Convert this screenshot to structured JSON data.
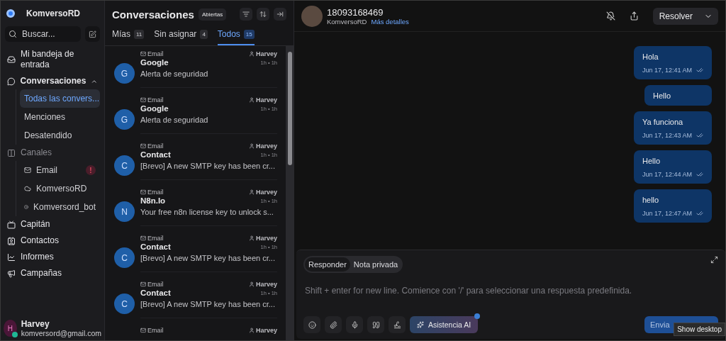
{
  "sidebar": {
    "brand": "KomversoRD",
    "search": {
      "placeholder": "Buscar..."
    },
    "nav": [
      {
        "label": "Mi bandeja de entrada",
        "kind": "link"
      },
      {
        "label": "Conversaciones",
        "kind": "group",
        "expanded": true,
        "children": [
          {
            "label": "Todas las convers...",
            "selected": true
          },
          {
            "label": "Menciones",
            "selected": false
          },
          {
            "label": "Desatendido",
            "selected": false
          }
        ]
      },
      {
        "label": "Canales",
        "kind": "section",
        "children": [
          {
            "label": "Email",
            "alert": "!"
          },
          {
            "label": "KomversoRD"
          },
          {
            "label": "Komversord_bot"
          }
        ]
      },
      {
        "label": "Capitán",
        "kind": "link"
      },
      {
        "label": "Contactos",
        "kind": "link"
      },
      {
        "label": "Informes",
        "kind": "link"
      },
      {
        "label": "Campañas",
        "kind": "link"
      }
    ],
    "user": {
      "initial": "H",
      "name": "Harvey",
      "email": "komversord@gmail.com",
      "online": true
    }
  },
  "list": {
    "title": "Conversaciones",
    "status": "Abiertas",
    "tabs": [
      {
        "label": "Mías",
        "count": "11",
        "selected": false
      },
      {
        "label": "Sin asignar",
        "count": "4",
        "selected": false
      },
      {
        "label": "Todos",
        "count": "15",
        "selected": true
      }
    ],
    "rows": [
      {
        "channel": "Email",
        "assignee": "Harvey",
        "avatar": "G",
        "name": "Google",
        "time": "1h • 1h",
        "preview": "Alerta de seguridad"
      },
      {
        "channel": "Email",
        "assignee": "Harvey",
        "avatar": "G",
        "name": "Google",
        "time": "1h • 1h",
        "preview": "Alerta de seguridad"
      },
      {
        "channel": "Email",
        "assignee": "Harvey",
        "avatar": "C",
        "name": "Contact",
        "time": "1h • 1h",
        "preview": "[Brevo] A new SMTP key has been cr..."
      },
      {
        "channel": "Email",
        "assignee": "Harvey",
        "avatar": "N",
        "name": "N8n.Io",
        "time": "1h • 1h",
        "preview": "Your free n8n license key to unlock s..."
      },
      {
        "channel": "Email",
        "assignee": "Harvey",
        "avatar": "C",
        "name": "Contact",
        "time": "1h • 1h",
        "preview": "[Brevo] A new SMTP key has been cr..."
      },
      {
        "channel": "Email",
        "assignee": "Harvey",
        "avatar": "C",
        "name": "Contact",
        "time": "1h • 1h",
        "preview": "[Brevo] A new SMTP key has been cr..."
      },
      {
        "channel": "Email",
        "assignee": "Harvey"
      }
    ]
  },
  "chat": {
    "contact": "18093168469",
    "inbox": "KomversoRD",
    "details_link": "Más detalles",
    "resolve": "Resolver",
    "messages": [
      {
        "text": "Hola",
        "time": "Jun 17, 12:41 AM"
      },
      {
        "text": "Hello"
      },
      {
        "text": "Ya funciona",
        "time": "Jun 17, 12:43 AM"
      },
      {
        "text": "Hello",
        "time": "Jun 17, 12:44 AM"
      },
      {
        "text": "hello",
        "time": "Jun 17, 12:47 AM"
      }
    ],
    "composer": {
      "modes": [
        {
          "label": "Responder",
          "selected": true
        },
        {
          "label": "Nota privada",
          "selected": false
        }
      ],
      "placeholder": "Shift + enter for new line. Comience con '/' para seleccionar una respuesta predefinida.",
      "ai_button": "Asistencia AI",
      "send": "Envia"
    }
  },
  "tooltip": "Show desktop"
}
